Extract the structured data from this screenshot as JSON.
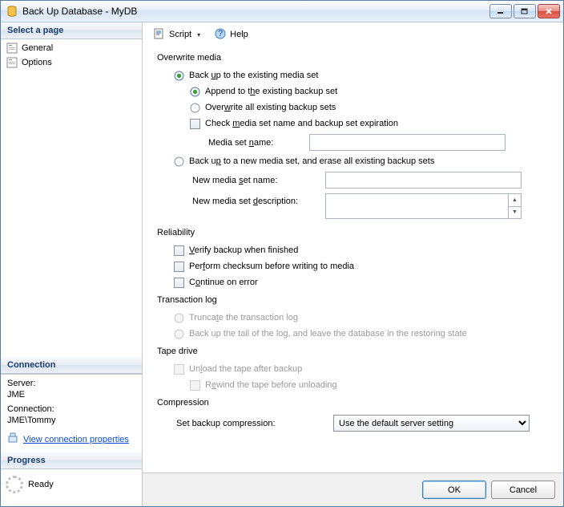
{
  "title": "Back Up Database - MyDB",
  "left": {
    "select_page": "Select a page",
    "general": "General",
    "options": "Options",
    "connection_hdr": "Connection",
    "server_lbl": "Server:",
    "server_val": "JME",
    "conn_lbl": "Connection:",
    "conn_val": "JME\\Tommy",
    "view_conn": "View connection properties",
    "progress_hdr": "Progress",
    "progress_state": "Ready"
  },
  "toolbar": {
    "script": "Script",
    "help": "Help"
  },
  "content": {
    "overwrite_media": "Overwrite media",
    "backup_existing_pre": "Back ",
    "backup_existing_u": "u",
    "backup_existing_post": "p to the existing media set",
    "append_pre": "Append to t",
    "append_u": "h",
    "append_post": "e existing backup set",
    "overwrite_all_pre": "Over",
    "overwrite_all_u": "w",
    "overwrite_all_post": "rite all existing backup sets",
    "check_pre": "Check ",
    "check_u": "m",
    "check_post": "edia set name and backup set expiration",
    "media_set_name_pre": "Media set ",
    "media_set_name_u": "n",
    "media_set_name_post": "ame:",
    "backup_new_pre": "Back u",
    "backup_new_u": "p",
    "backup_new_post": " to a new media set, and erase all existing backup sets",
    "new_media_name_pre": "New media ",
    "new_media_name_u": "s",
    "new_media_name_post": "et name:",
    "new_media_desc_pre": "New media set ",
    "new_media_desc_u": "d",
    "new_media_desc_post": "escription:",
    "reliability": "Reliability",
    "verify_pre": "",
    "verify_u": "V",
    "verify_post": "erify backup when finished",
    "checksum_pre": "Per",
    "checksum_u": "f",
    "checksum_post": "orm checksum before writing to media",
    "continue_pre": "C",
    "continue_u": "o",
    "continue_post": "ntinue on error",
    "txlog": "Transaction log",
    "truncate_pre": "Trunca",
    "truncate_u": "t",
    "truncate_post": "e the transaction log",
    "tail_pre": "Back up the tail of the lo",
    "tail_u": "g",
    "tail_post": ", and leave the database in the restoring state",
    "tape": "Tape drive",
    "unload_pre": "Un",
    "unload_u": "l",
    "unload_post": "oad the tape after backup",
    "rewind_pre": "R",
    "rewind_u": "e",
    "rewind_post": "wind the tape before unloading",
    "compression": "Compression",
    "set_compression": "Set backup compression:",
    "compression_value": "Use the default server setting"
  },
  "footer": {
    "ok": "OK",
    "cancel": "Cancel"
  }
}
